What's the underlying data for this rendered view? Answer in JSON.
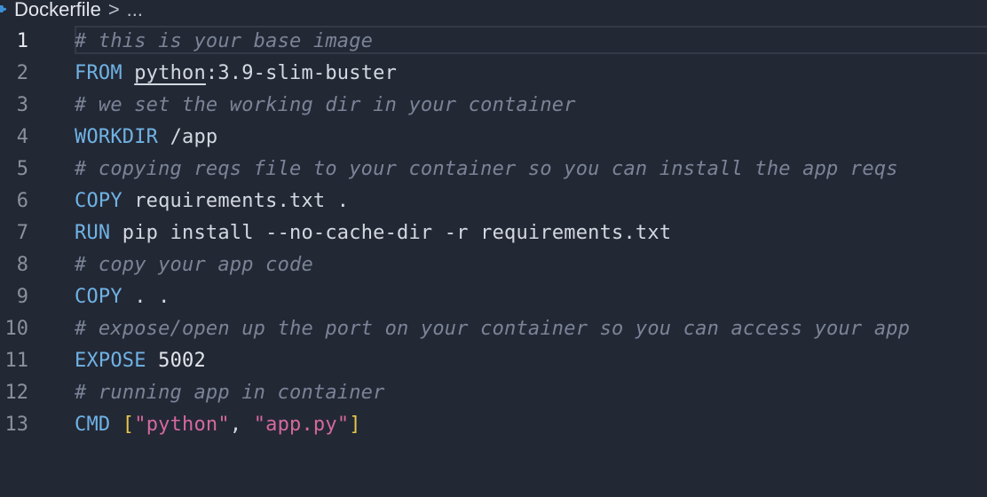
{
  "breadcrumb": {
    "file": "Dockerfile",
    "separator": ">",
    "ellipsis": "..."
  },
  "editor": {
    "active_line": 1,
    "lines": [
      {
        "number": "1",
        "tokens": [
          {
            "t": "comment",
            "v": "# this is your base image"
          }
        ]
      },
      {
        "number": "2",
        "tokens": [
          {
            "t": "kw",
            "v": "FROM"
          },
          {
            "t": "plain",
            "v": " "
          },
          {
            "t": "underline",
            "v": "python"
          },
          {
            "t": "plain",
            "v": ":3.9-slim-buster"
          }
        ]
      },
      {
        "number": "3",
        "tokens": [
          {
            "t": "comment",
            "v": "# we set the working dir in your container"
          }
        ]
      },
      {
        "number": "4",
        "tokens": [
          {
            "t": "kw",
            "v": "WORKDIR"
          },
          {
            "t": "plain",
            "v": " /app"
          }
        ]
      },
      {
        "number": "5",
        "tokens": [
          {
            "t": "comment",
            "v": "# copying reqs file to your container so you can install the app reqs"
          }
        ]
      },
      {
        "number": "6",
        "tokens": [
          {
            "t": "kw",
            "v": "COPY"
          },
          {
            "t": "plain",
            "v": " requirements.txt ."
          }
        ]
      },
      {
        "number": "7",
        "tokens": [
          {
            "t": "kw",
            "v": "RUN"
          },
          {
            "t": "plain",
            "v": " pip install --no-cache-dir -r requirements.txt"
          }
        ]
      },
      {
        "number": "8",
        "tokens": [
          {
            "t": "comment",
            "v": "# copy your app code"
          }
        ]
      },
      {
        "number": "9",
        "tokens": [
          {
            "t": "kw",
            "v": "COPY"
          },
          {
            "t": "plain",
            "v": " . ."
          }
        ]
      },
      {
        "number": "10",
        "tokens": [
          {
            "t": "comment",
            "v": "# expose/open up the port on your container so you can access your app"
          }
        ]
      },
      {
        "number": "11",
        "tokens": [
          {
            "t": "kw",
            "v": "EXPOSE"
          },
          {
            "t": "plain",
            "v": " "
          },
          {
            "t": "num",
            "v": "5002"
          }
        ]
      },
      {
        "number": "12",
        "tokens": [
          {
            "t": "comment",
            "v": "# running app in container"
          }
        ]
      },
      {
        "number": "13",
        "tokens": [
          {
            "t": "kw",
            "v": "CMD"
          },
          {
            "t": "plain",
            "v": " "
          },
          {
            "t": "bracket",
            "v": "["
          },
          {
            "t": "str",
            "v": "\"python\""
          },
          {
            "t": "plain",
            "v": ", "
          },
          {
            "t": "str",
            "v": "\"app.py\""
          },
          {
            "t": "bracket",
            "v": "]"
          }
        ]
      }
    ]
  },
  "colors": {
    "background": "#232835",
    "keyword": "#6fb3e4",
    "comment": "#7b8497",
    "string": "#d36a9c",
    "bracket": "#e6c64a",
    "docker_icon": "#3d8fd6"
  },
  "icons": {
    "file_icon": "docker-icon"
  }
}
